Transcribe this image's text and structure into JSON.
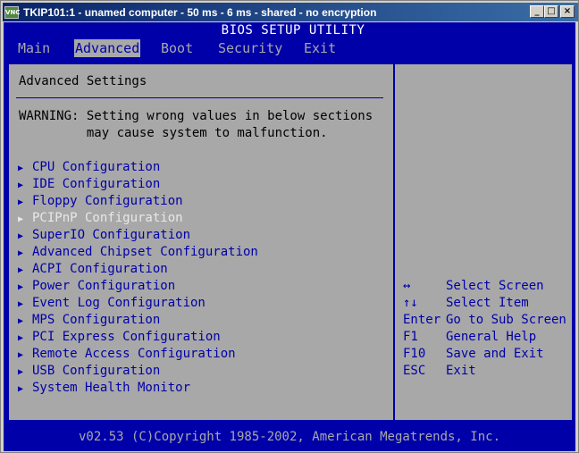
{
  "window": {
    "title": "TKIP101:1 - unamed computer - 50 ms - 6 ms - shared - no encryption",
    "app_icon": "VNC"
  },
  "bios": {
    "title": "BIOS SETUP UTILITY",
    "tabs": [
      {
        "label": "Main"
      },
      {
        "label": "Advanced"
      },
      {
        "label": "Boot"
      },
      {
        "label": "Security"
      },
      {
        "label": "Exit"
      }
    ],
    "active_tab": "Advanced",
    "panel_title": "Advanced Settings",
    "warning_line1": "WARNING: Setting wrong values in below sections",
    "warning_line2": "         may cause system to malfunction.",
    "menu_items": [
      {
        "label": "CPU Configuration"
      },
      {
        "label": "IDE Configuration"
      },
      {
        "label": "Floppy Configuration"
      },
      {
        "label": "PCIPnP Configuration"
      },
      {
        "label": "SuperIO Configuration"
      },
      {
        "label": "Advanced Chipset Configuration"
      },
      {
        "label": "ACPI Configuration"
      },
      {
        "label": "Power Configuration"
      },
      {
        "label": "Event Log Configuration"
      },
      {
        "label": "MPS Configuration"
      },
      {
        "label": "PCI Express Configuration"
      },
      {
        "label": "Remote Access Configuration"
      },
      {
        "label": "USB Configuration"
      },
      {
        "label": "System Health Monitor"
      }
    ],
    "help": [
      {
        "key": "↔",
        "action": "Select Screen"
      },
      {
        "key": "↑↓",
        "action": "Select Item"
      },
      {
        "key": "Enter",
        "action": "Go to Sub Screen"
      },
      {
        "key": "F1",
        "action": "General Help"
      },
      {
        "key": "F10",
        "action": "Save and Exit"
      },
      {
        "key": "ESC",
        "action": "Exit"
      }
    ],
    "footer": "v02.53 (C)Copyright 1985-2002, American Megatrends, Inc."
  },
  "colors": {
    "bios_blue": "#0000a8",
    "bios_gray": "#a8a8a8",
    "disabled_item": "#e8e8e8"
  }
}
